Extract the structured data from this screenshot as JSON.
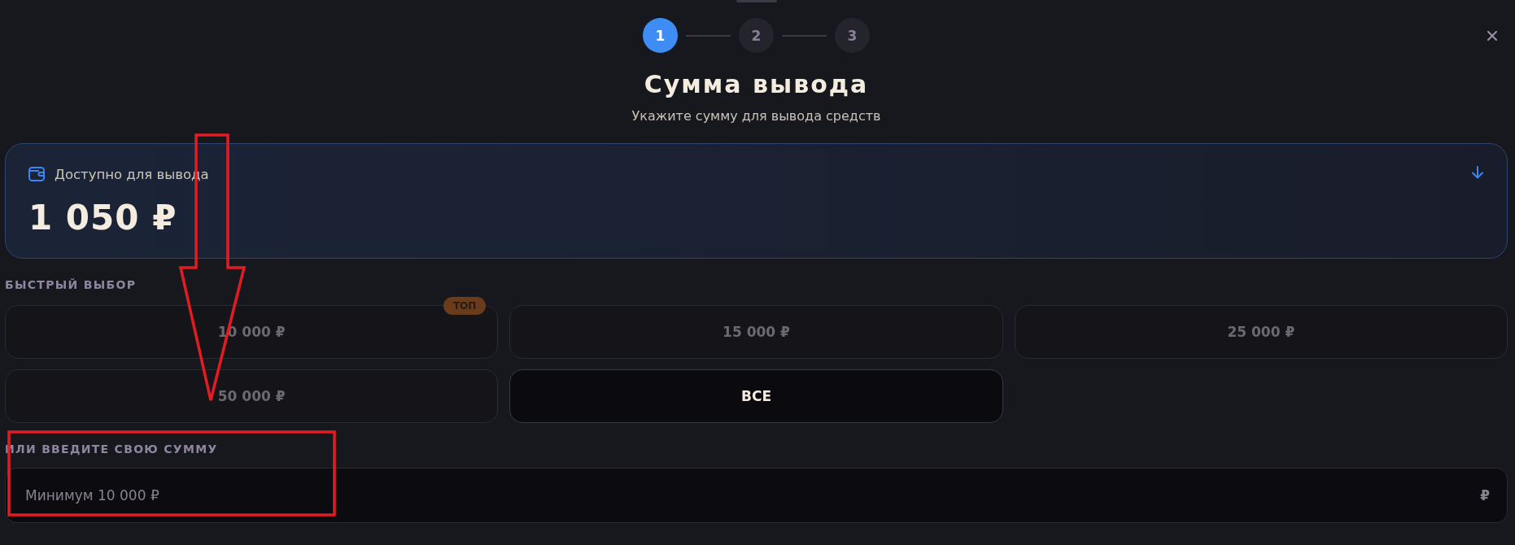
{
  "stepper": {
    "steps": [
      {
        "label": "1",
        "selected": true
      },
      {
        "label": "2",
        "selected": false
      },
      {
        "label": "3",
        "selected": false
      }
    ]
  },
  "header": {
    "title": "Сумма вывода",
    "subtitle": "Укажите сумму для вывода средств"
  },
  "balance_card": {
    "label": "Доступно для вывода",
    "amount": "1 050 ₽"
  },
  "quick_select": {
    "label": "БЫСТРЫЙ ВЫБОР",
    "options": [
      {
        "label": "10 000 ₽",
        "badge": "ТОП",
        "disabled": true
      },
      {
        "label": "15 000 ₽",
        "disabled": true
      },
      {
        "label": "25 000 ₽",
        "disabled": true
      },
      {
        "label": "50 000 ₽",
        "disabled": true
      },
      {
        "label": "ВСЕ",
        "disabled": false
      }
    ]
  },
  "custom_amount": {
    "label": "ИЛИ ВВЕДИТЕ СВОЮ СУММУ",
    "placeholder": "Минимум 10 000 ₽",
    "currency": "₽"
  },
  "annotations": {
    "arrow": true,
    "highlight_box": true
  }
}
